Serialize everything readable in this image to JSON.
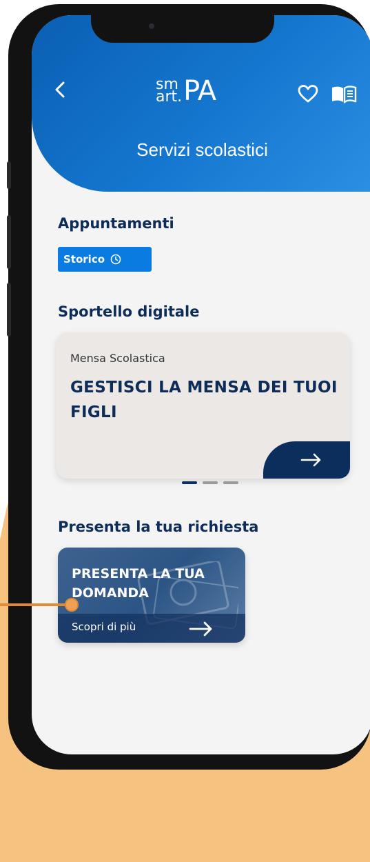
{
  "header": {
    "logo_sm": "sm",
    "logo_art": "art.",
    "logo_pa": "PA",
    "title": "Servizi scolastici",
    "back_icon": "chevron-left-icon",
    "favorite_icon": "heart-icon",
    "guide_icon": "book-icon"
  },
  "appuntamenti": {
    "title": "Appuntamenti",
    "storico_label": "Storico",
    "storico_icon": "clock-icon"
  },
  "sportello": {
    "title": "Sportello digitale",
    "card": {
      "subtitle": "Mensa Scolastica",
      "title": "GESTISCI LA MENSA DEI TUOI FIGLI",
      "arrow_icon": "arrow-right-icon"
    },
    "pager": {
      "pages": 3,
      "active": 1
    }
  },
  "richiesta": {
    "title": "Presenta la tua richiesta",
    "card": {
      "title_line1": "PRESENTA LA TUA",
      "title_line2": "DOMANDA",
      "link": "Scopri di più",
      "arrow_icon": "arrow-right-icon"
    }
  },
  "colors": {
    "header_blue": "#0a5fb3",
    "navy": "#0d2c58",
    "accent_blue": "#0a7be0",
    "highlight_orange": "#f5c27f"
  }
}
